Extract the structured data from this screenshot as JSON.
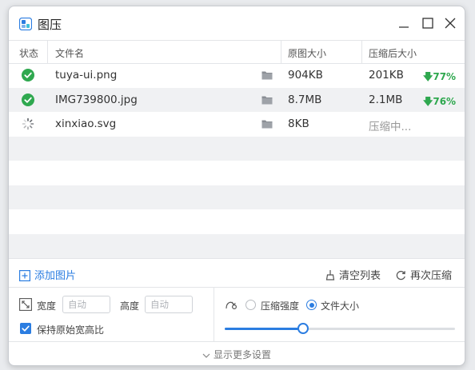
{
  "window": {
    "title": "图压",
    "accent": "#2b7de1"
  },
  "columns": {
    "status": "状态",
    "filename": "文件名",
    "original_size": "原图大小",
    "compressed_size": "压缩后大小"
  },
  "files": [
    {
      "status": "done",
      "name": "tuya-ui.png",
      "original": "904KB",
      "compressed": "201KB",
      "ratio": "77%"
    },
    {
      "status": "done",
      "name": "IMG739800.jpg",
      "original": "8.7MB",
      "compressed": "2.1MB",
      "ratio": "76%"
    },
    {
      "status": "processing",
      "name": "xinxiao.svg",
      "original": "8KB",
      "compressed": "压缩中...",
      "ratio": ""
    }
  ],
  "toolbar": {
    "add_label": "添加图片",
    "clear_label": "清空列表",
    "recompress_label": "再次压缩"
  },
  "settings": {
    "width_label": "宽度",
    "width_placeholder": "自动",
    "height_label": "高度",
    "height_placeholder": "自动",
    "keep_ratio_label": "保持原始宽高比",
    "keep_ratio_checked": true,
    "mode_strength_label": "压缩强度",
    "mode_filesize_label": "文件大小",
    "selected_mode": "filesize",
    "slider_fraction": 0.34
  },
  "footer": {
    "more_settings_label": "显示更多设置"
  },
  "colors": {
    "success": "#2fa84f",
    "accent": "#2b7de1"
  },
  "icons": {
    "app": "app-logo-icon",
    "done": "check-circle-icon",
    "processing": "spinner-icon",
    "folder": "folder-icon"
  }
}
